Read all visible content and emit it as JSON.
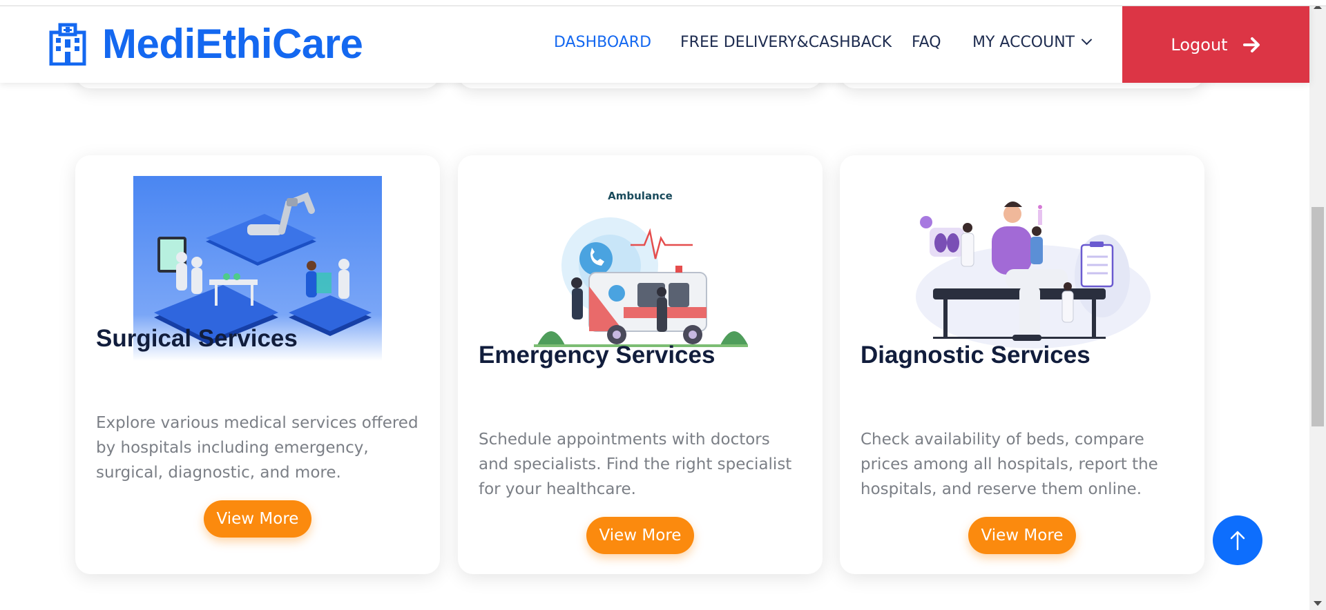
{
  "brand": {
    "name": "MediEthiCare",
    "icon": "hospital-building-icon",
    "color": "#1468f0"
  },
  "nav": {
    "items": [
      {
        "label": "DASHBOARD",
        "active": true
      },
      {
        "label": "FREE DELIVERY&CASHBACK",
        "active": false
      },
      {
        "label": "FAQ",
        "active": false
      },
      {
        "label": "MY ACCOUNT",
        "active": false,
        "dropdown": true
      }
    ],
    "logout_label": "Logout",
    "logout_icon": "arrow-right-icon",
    "logout_color": "#dc3545"
  },
  "cards": [
    {
      "title": "Surgical Services",
      "description": "Explore various medical services offered by hospitals including emergency, surgical, diagnostic, and more.",
      "button": "View More"
    },
    {
      "title": "Emergency Services",
      "image_caption": "Ambulance",
      "description": "Schedule appointments with doctors and specialists. Find the right specialist for your healthcare.",
      "button": "View More"
    },
    {
      "title": "Diagnostic Services",
      "description": "Check availability of beds, compare prices among all hospitals, report the hospitals, and reserve them online.",
      "button": "View More"
    }
  ],
  "scroll_top_icon": "arrow-up-icon",
  "colors": {
    "accent": "#fb8a0e",
    "primary": "#0d6efd",
    "title": "#111d3c"
  }
}
